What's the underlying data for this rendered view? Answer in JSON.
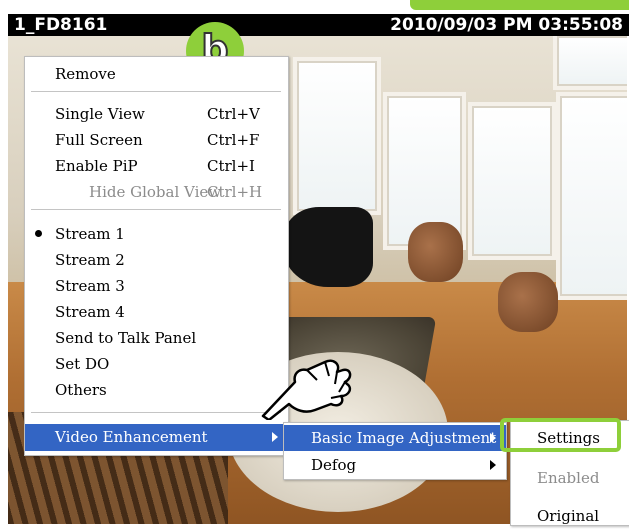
{
  "camera": {
    "name": "1_FD8161",
    "timestamp": "2010/09/03 PM 03:55:08"
  },
  "badge": {
    "letter": "b",
    "color": "#8ecf3a"
  },
  "context_menu": {
    "items": [
      {
        "label": "Remove",
        "shortcut": ""
      },
      {
        "label": "Single View",
        "shortcut": "Ctrl+V"
      },
      {
        "label": "Full Screen",
        "shortcut": "Ctrl+F"
      },
      {
        "label": "Enable PiP",
        "shortcut": "Ctrl+I"
      },
      {
        "label": "Hide Global View",
        "shortcut": "Ctrl+H"
      },
      {
        "label": "Stream 1",
        "shortcut": ""
      },
      {
        "label": "Stream 2",
        "shortcut": ""
      },
      {
        "label": "Stream 3",
        "shortcut": ""
      },
      {
        "label": "Stream 4",
        "shortcut": ""
      },
      {
        "label": "Send to Talk Panel",
        "shortcut": ""
      },
      {
        "label": "Set DO",
        "shortcut": ""
      },
      {
        "label": "Others",
        "shortcut": ""
      },
      {
        "label": "Video Enhancement",
        "shortcut": ""
      }
    ]
  },
  "submenu_video": {
    "items": [
      {
        "label": "Basic Image Adjustment"
      },
      {
        "label": "Defog"
      }
    ]
  },
  "submenu_basic": {
    "items": [
      {
        "label": "Settings"
      },
      {
        "label": "Enabled"
      },
      {
        "label": "Original"
      }
    ]
  },
  "colors": {
    "highlight": "#3365c4",
    "accent": "#8ecf3a"
  },
  "icons": {
    "pointer": "hand-pointer-icon",
    "submenu_arrow": "chevron-right-icon",
    "radio_selected": "bullet-icon"
  }
}
